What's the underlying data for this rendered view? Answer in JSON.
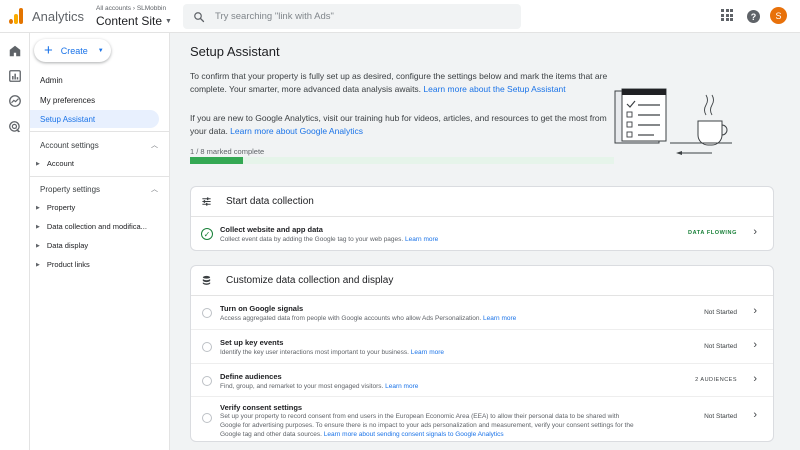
{
  "header": {
    "app_name": "Analytics",
    "account_path": "All accounts › SLMobbin",
    "property_name": "Content Site",
    "search_placeholder": "Try searching \"link with Ads\"",
    "avatar_letter": "S",
    "help_glyph": "?"
  },
  "rail": {
    "icons": [
      "home-icon",
      "reports-icon",
      "explore-icon",
      "advertising-icon"
    ]
  },
  "sidebar": {
    "create_label": "Create",
    "items": [
      {
        "label": "Admin",
        "active": false
      },
      {
        "label": "My preferences",
        "active": false
      },
      {
        "label": "Setup Assistant",
        "active": true
      }
    ],
    "account_settings": {
      "label": "Account settings",
      "items": [
        "Account"
      ]
    },
    "property_settings": {
      "label": "Property settings",
      "items": [
        "Property",
        "Data collection and modifica...",
        "Data display",
        "Product links"
      ]
    }
  },
  "main": {
    "title": "Setup Assistant",
    "intro1_text": "To confirm that your property is fully set up as desired, configure the settings below and mark the items that are complete. Your smarter, more advanced data analysis awaits. ",
    "intro1_link": "Learn more about the Setup Assistant",
    "intro2_text": "If you are new to Google Analytics, visit our training hub for videos, articles, and resources to get the most from your data. ",
    "intro2_link": "Learn more about Google Analytics",
    "progress_label": "1 / 8 marked complete",
    "progress_completed": 1,
    "progress_total": 8
  },
  "sections": [
    {
      "title": "Start data collection",
      "icon": "tune-icon",
      "tasks": [
        {
          "title": "Collect website and app data",
          "desc": "Collect event data by adding the Google tag to your web pages. ",
          "link": "Learn more",
          "status": "DATA FLOWING",
          "complete": true
        }
      ]
    },
    {
      "title": "Customize data collection and display",
      "icon": "database-icon",
      "tasks": [
        {
          "title": "Turn on Google signals",
          "desc": "Access aggregated data from people with Google accounts who allow Ads Personalization. ",
          "link": "Learn more",
          "status": "Not Started",
          "complete": false
        },
        {
          "title": "Set up key events",
          "desc": "Identify the key user interactions most important to your business. ",
          "link": "Learn more",
          "status": "Not Started",
          "complete": false
        },
        {
          "title": "Define audiences",
          "desc": "Find, group, and remarket to your most engaged visitors. ",
          "link": "Learn more",
          "status": "2 AUDIENCES",
          "complete": false
        },
        {
          "title": "Verify consent settings",
          "desc": "Set up your property to record consent from end users in the European Economic Area (EEA) to allow their personal data to be shared with Google for advertising purposes. To ensure there is no impact to your ads personalization and measurement, verify your consent settings for the Google tag and other data sources. ",
          "link": "Learn more about sending consent signals to Google Analytics",
          "status": "Not Started",
          "complete": false
        }
      ]
    }
  ]
}
